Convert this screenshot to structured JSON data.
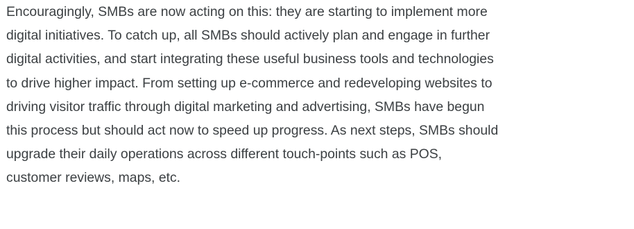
{
  "paragraph": {
    "lines": [
      "Encouragingly, SMBs are now acting on this: they are starting to implement more",
      "digital initiatives. To catch up, all SMBs should actively plan and engage in further",
      "digital activities, and start integrating these useful business tools and technologies",
      "to drive higher impact. From setting up e-commerce and redeveloping websites to",
      "driving visitor traffic through digital marketing and advertising, SMBs have begun",
      "this process but should act now to speed up progress. As next steps, SMBs should",
      "upgrade their daily operations across different touch-points such as POS,",
      "customer reviews, maps, etc."
    ],
    "text_color": "#3c4043"
  }
}
